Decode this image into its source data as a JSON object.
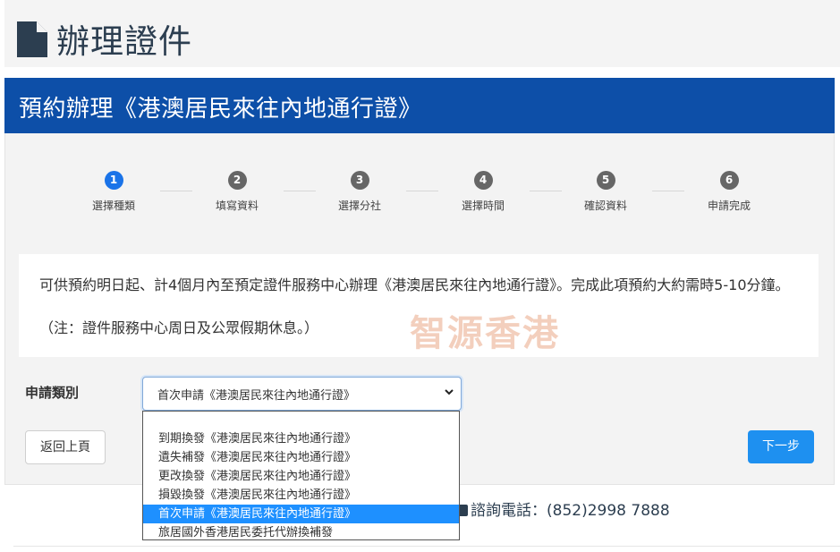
{
  "header": {
    "title": "辦理證件",
    "icon": "document-icon"
  },
  "banner": {
    "title": "預約辦理《港澳居民來往內地通行證》"
  },
  "steps": [
    {
      "number": "1",
      "label": "選擇種類"
    },
    {
      "number": "2",
      "label": "填寫資料"
    },
    {
      "number": "3",
      "label": "選擇分社"
    },
    {
      "number": "4",
      "label": "選擇時間"
    },
    {
      "number": "5",
      "label": "確認資料"
    },
    {
      "number": "6",
      "label": "申請完成"
    }
  ],
  "info": {
    "text": "可供預約明日起、計4個月內至預定證件服務中心辦理《港澳居民來往內地通行證》。完成此項預約大約需時5-10分鐘。",
    "note": "（注：證件服務中心周日及公眾假期休息。）"
  },
  "watermark": "智源香港",
  "form": {
    "label": "申請類別",
    "selected": "首次申請《港澳居民來往內地通行證》",
    "options": [
      "到期換發《港澳居民來往內地通行證》",
      "遺失補發《港澳居民來往內地通行證》",
      "更改換發《港澳居民來往內地通行證》",
      "損毀換發《港澳居民來往內地通行證》",
      "首次申請《港澳居民來往內地通行證》",
      "旅居國外香港居民委托代辦換補發"
    ]
  },
  "buttons": {
    "back": "返回上頁",
    "next": "下一步"
  },
  "contact": {
    "text": "諮詢電話：(852)2998 7888",
    "icon": "phone-icon"
  },
  "colors": {
    "banner": "#0d4fa8",
    "active_step": "#1a73e8",
    "next_button": "#1e90f0",
    "selected_option": "#1e90ff"
  }
}
